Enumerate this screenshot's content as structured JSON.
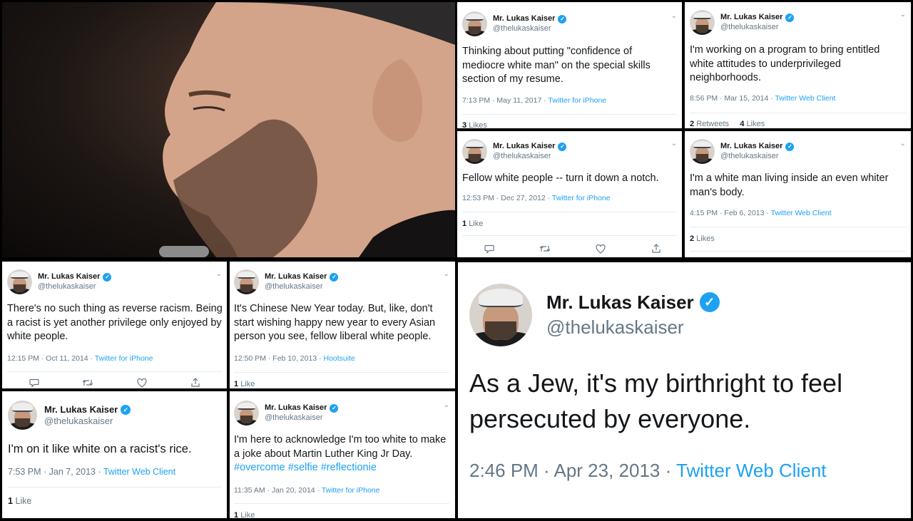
{
  "profile": {
    "name": "Mr. Lukas Kaiser",
    "handle": "@thelukaskaiser"
  },
  "colors": {
    "link": "#1da1f2",
    "badge": "#1da1f2",
    "muted": "#657786"
  },
  "icons": [
    "verified-badge-icon",
    "chevron-down-icon",
    "reply-icon",
    "retweet-icon",
    "like-icon",
    "share-icon"
  ],
  "tweets": [
    {
      "text": "Thinking about putting \"confidence of mediocre white man\" on the special skills section of my resume.",
      "time": "7:13 PM · May 11, 2017 · ",
      "source": "Twitter for iPhone",
      "stats": {
        "count1": "3",
        "label1": "Likes"
      }
    },
    {
      "text": "I'm working on a program to bring entitled white attitudes to underprivileged neighborhoods.",
      "time": "8:56 PM · Mar 15, 2014 · ",
      "source": "Twitter Web Client",
      "stats": {
        "count1": "2",
        "label1": "Retweets",
        "count2": "4",
        "label2": "Likes"
      }
    },
    {
      "text": "Fellow white people -- turn it down a notch.",
      "time": "12:53 PM · Dec 27, 2012 · ",
      "source": "Twitter for iPhone",
      "stats": {
        "count1": "1",
        "label1": "Like"
      }
    },
    {
      "text": "I'm a white man living inside an even whiter man's body.",
      "time": "4:15 PM · Feb 6, 2013 · ",
      "source": "Twitter Web Client",
      "stats": {
        "count1": "2",
        "label1": "Likes"
      }
    },
    {
      "text": "There's no such thing as reverse racism. Being a racist is yet another privilege only enjoyed by white people.",
      "time": "12:15 PM · Oct 11, 2014 · ",
      "source": "Twitter for iPhone"
    },
    {
      "text": "It's Chinese New Year today. But, like, don't start wishing happy new year to every Asian person you see, fellow liberal white people.",
      "time": "12:50 PM · Feb 10, 2013 · ",
      "source": "Hootsuite",
      "stats": {
        "count1": "1",
        "label1": "Like"
      }
    },
    {
      "text": "I'm on it like white on a racist's rice.",
      "time": "7:53 PM · Jan 7, 2013 · ",
      "source": "Twitter Web Client",
      "stats": {
        "count1": "1",
        "label1": "Like"
      }
    },
    {
      "text_main": "I'm here to acknowledge I'm too white to make a joke about Martin Luther King Jr Day. ",
      "hashtags": "#overcome #selfie #reflectionie",
      "time": "11:35 AM · Jan 20, 2014 · ",
      "source": "Twitter for iPhone",
      "stats": {
        "count1": "1",
        "label1": "Like"
      }
    },
    {
      "text": "As a Jew, it's my birthright to feel persecuted by everyone.",
      "time": "2:46 PM · Apr 23, 2013 · ",
      "source": "Twitter Web Client"
    }
  ]
}
